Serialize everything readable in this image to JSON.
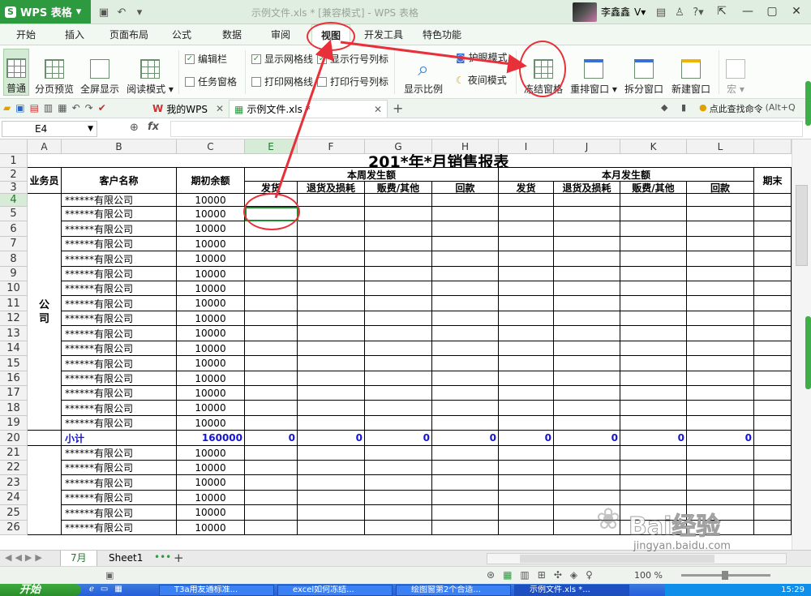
{
  "app": {
    "name": "WPS 表格",
    "logo_letter": "S",
    "window_title": "示例文件.xls * [兼容模式] - WPS 表格",
    "user_name": "李鑫鑫"
  },
  "menu_tabs": [
    "开始",
    "插入",
    "页面布局",
    "公式",
    "数据",
    "审阅",
    "视图",
    "开发工具",
    "特色功能"
  ],
  "active_tab": "视图",
  "ribbon": {
    "normal": "普通",
    "page_preview": "分页预览",
    "fullscreen": "全屏显示",
    "reading_mode": "阅读模式",
    "edit_bar": "编辑栏",
    "task_pane": "任务窗格",
    "show_gridlines": "显示网格线",
    "show_row_col_headers": "显示行号列标",
    "print_gridlines": "打印网格线",
    "print_row_col_headers": "打印行号列标",
    "zoom": "显示比例",
    "eye_mode": "护眼模式",
    "night_mode": "夜间模式",
    "freeze_panes": "冻结窗格",
    "arrange_windows": "重排窗口",
    "split_window": "拆分窗口",
    "new_window": "新建窗口",
    "macro": "宏"
  },
  "doc_tabs": [
    {
      "label": "我的WPS"
    },
    {
      "label": "示例文件.xls *"
    }
  ],
  "search_hint": "点此查找命令",
  "search_shortcut": "(Alt+Q",
  "name_box": "E4",
  "columns": [
    "A",
    "B",
    "C",
    "E",
    "F",
    "G",
    "H",
    "I",
    "J",
    "K",
    "L"
  ],
  "rows": [
    "1",
    "2",
    "3",
    "4",
    "5",
    "6",
    "7",
    "8",
    "9",
    "10",
    "11",
    "12",
    "13",
    "14",
    "15",
    "16",
    "17",
    "18",
    "19",
    "20",
    "21",
    "22",
    "23",
    "24",
    "25",
    "26"
  ],
  "sheet": {
    "title": "201*年*月销售报表",
    "hdr_salesperson": "业务员",
    "hdr_customer": "客户名称",
    "hdr_opening": "期初余额",
    "hdr_week": "本周发生额",
    "hdr_month": "本月发生额",
    "hdr_end": "期末",
    "sub_headers": [
      "发货",
      "退货及损耗",
      "贩费/其他",
      "回款"
    ],
    "company_label": "公\n司",
    "customer_name": "******有限公司",
    "opening_value": "10000",
    "subtotal_label": "小计",
    "subtotal_opening": "160000",
    "subtotal_zero": "0"
  },
  "sheet_tabs": [
    "7月",
    "Sheet1"
  ],
  "status": {
    "zoom_label": "100 %"
  },
  "taskbar": {
    "start": "开始",
    "items": [
      "T3a用友通标准...",
      "excel如何冻结...",
      "绘图窗第2个合适...",
      "示例文件.xls *..."
    ],
    "time": "15:29"
  },
  "watermark": {
    "brand": "Bai经验",
    "url": "jingyan.baidu.com"
  }
}
